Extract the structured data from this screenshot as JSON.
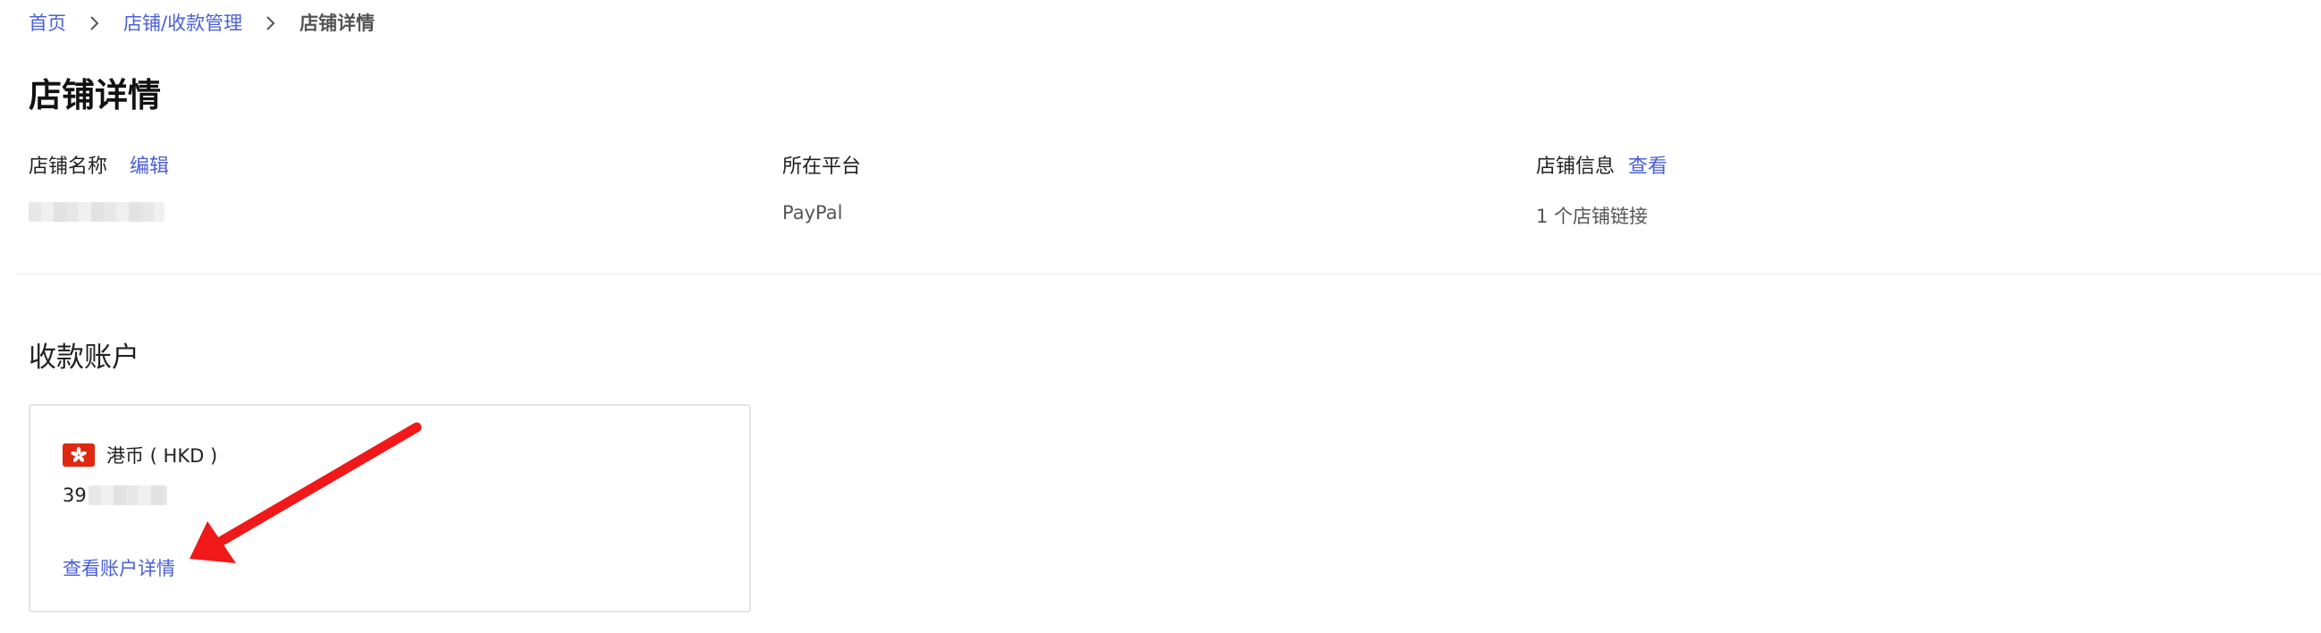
{
  "breadcrumb": {
    "home": "首页",
    "store_management": "店铺/收款管理",
    "current": "店铺详情"
  },
  "page_title": "店铺详情",
  "store_info": {
    "name_label": "店铺名称",
    "edit_link": "编辑",
    "platform_label": "所在平台",
    "platform_value": "PayPal",
    "info_label": "店铺信息",
    "view_link": "查看",
    "links_value": "1 个店铺链接"
  },
  "accounts": {
    "section_title": "收款账户",
    "card": {
      "currency": "港币 ( HKD )",
      "account_prefix": "39",
      "view_details": "查看账户详情"
    }
  },
  "colors": {
    "link": "#4a5fd6",
    "flag_red": "#de2910",
    "annotation_red": "#f01818"
  }
}
